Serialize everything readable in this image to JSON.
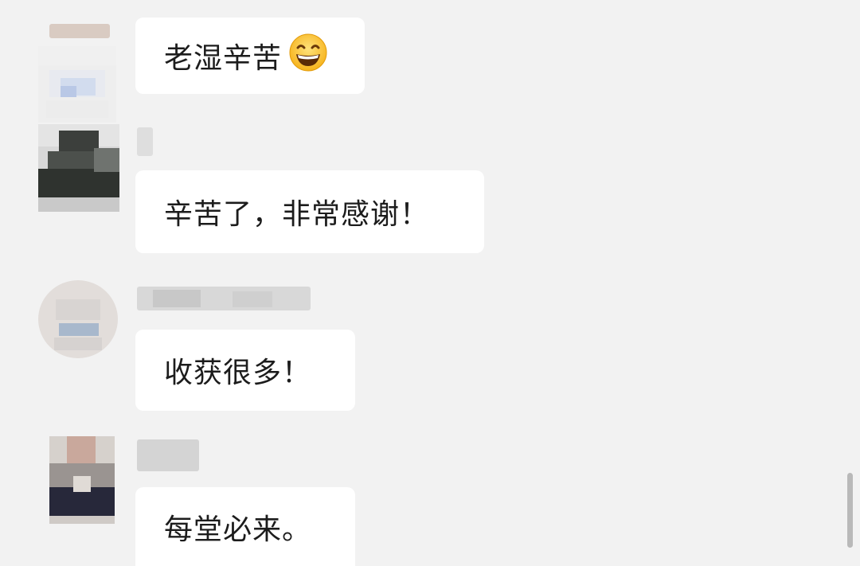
{
  "messages": [
    {
      "text": "老湿辛苦",
      "icon": "grinning-face-emoji"
    },
    {
      "text": "辛苦了，非常感谢！"
    },
    {
      "text": "收获很多！"
    },
    {
      "text": "每堂必来。"
    }
  ],
  "colors": {
    "background": "#f2f2f2",
    "bubble": "#ffffff",
    "text": "#1c1c1c",
    "scrollbar": "#b9b9b9"
  }
}
